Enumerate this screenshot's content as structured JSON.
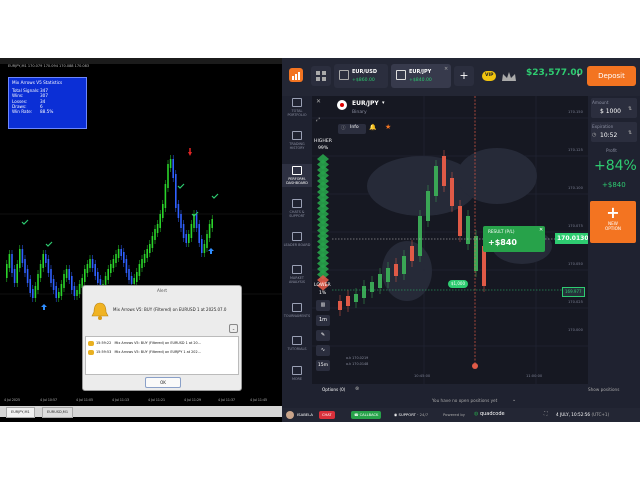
{
  "mt4": {
    "caption": "EURJPY,M1  170.079 170.094 170.088 170.083",
    "stats": {
      "title": "Mix Arrows V5 Statistics",
      "rows": [
        {
          "label": "Total Signals:",
          "value": "347"
        },
        {
          "label": "Wins:",
          "value": "307"
        },
        {
          "label": "Losses:",
          "value": "34"
        },
        {
          "label": "Draws:",
          "value": "6"
        },
        {
          "label": "Win Rate:",
          "value": "88.5%"
        }
      ]
    },
    "time_axis": [
      "4 Jul 2025",
      "4 Jul 10:57",
      "4 Jul 11:05",
      "4 Jul 11:13",
      "4 Jul 11:21",
      "4 Jul 11:29",
      "4 Jul 11:37",
      "4 Jul 11:45"
    ],
    "tabs": [
      "EURJPY,M1",
      "EURUSD,M1"
    ]
  },
  "alert": {
    "title": "Alert",
    "message": "Mix Arrows V5: BUY (Filtered) on EURUSD 1 at 2025.07.0",
    "rows": [
      {
        "time": "15:59:22",
        "text": "Mix Arrows V5: BUY (Filtered) on EURUSD 1 at 20..."
      },
      {
        "time": "15:59:53",
        "text": "Mix Arrows V5: BUY (Filtered) on EURJPY 1 at 202..."
      }
    ],
    "ok_label": "OK"
  },
  "qc": {
    "assets": [
      {
        "name": "EUR/USD",
        "profit": "+$860.00"
      },
      {
        "name": "EUR/JPY",
        "profit": "+$840.00"
      }
    ],
    "add_label": "+",
    "vip_label": "VIP",
    "balance": "$23,577.00",
    "deposit_label": "Deposit",
    "instrument": {
      "name": "EUR/JPY",
      "type": "Binary",
      "info": "Info"
    },
    "sidebar": [
      {
        "label": "TOTAL PORTFOLIO",
        "icon": "briefcase-icon"
      },
      {
        "label": "TRADING HISTORY",
        "icon": "history-icon"
      },
      {
        "label": "PERFORM. DASHBOARD",
        "icon": "dashboard-icon"
      },
      {
        "label": "CHATS & SUPPORT",
        "icon": "chat-icon"
      },
      {
        "label": "LEADER BOARD",
        "icon": "trophy-icon"
      },
      {
        "label": "MARKET ANALYSIS",
        "icon": "analysis-icon"
      },
      {
        "label": "TOURNAMENTS",
        "icon": "tournament-icon"
      },
      {
        "label": "TUTORIALS",
        "icon": "graduation-icon"
      },
      {
        "label": "MORE",
        "icon": "more-icon"
      }
    ],
    "higher": {
      "label": "HIGHER",
      "pct": "99%"
    },
    "lower": {
      "label": "LOWER",
      "pct": "1%"
    },
    "timeframes": [
      "1m",
      "15m"
    ],
    "price_axis": [
      "170.150",
      "170.125",
      "170.100",
      "170.075",
      "170.050",
      "170.025",
      "170.000",
      "169.975",
      "169.950"
    ],
    "current_price": "170.0130",
    "price_tag2": "169.977",
    "trade_marker": "$1,000",
    "time_axis": [
      "10:45:00",
      "11:00:00"
    ],
    "ohlc_line1": "o.k 170.0219",
    "ohlc_line2": "o.k 170.0148",
    "result": {
      "label": "RESULT (P/L)",
      "value": "+$840"
    },
    "amount": {
      "label": "Amount",
      "value": "$ 1000"
    },
    "expiration": {
      "label": "Expiration",
      "value": "10:52"
    },
    "profit": {
      "label": "Profit",
      "pct": "+84%",
      "value": "+$840"
    },
    "new_option": {
      "line1": "NEW",
      "line2": "OPTION"
    },
    "options": {
      "label": "Options (0)",
      "empty_text": "You have no open positions yet",
      "show_positions": "Show positions"
    },
    "bottom": {
      "user": "ISABELA",
      "chat": "CHAT",
      "callback": "CALLBACK",
      "support": "SUPPORT",
      "support_hours": "24/7",
      "powered_by": "Powered by",
      "brand": "quadcode",
      "datetime": "4 JULY, 10:52:56",
      "tz": "(UTC+1)"
    },
    "colors": {
      "green": "#2ecc71",
      "red": "#e05a47",
      "orange": "#f37421"
    }
  }
}
